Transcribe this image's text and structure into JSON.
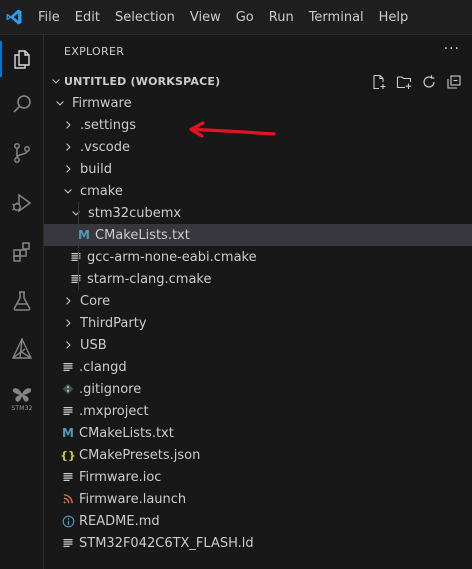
{
  "menubar": {
    "items": [
      "File",
      "Edit",
      "Selection",
      "View",
      "Go",
      "Run",
      "Terminal",
      "Help"
    ]
  },
  "activitybar": {
    "items": [
      "explorer",
      "search",
      "source-control",
      "run-and-debug",
      "extensions",
      "testing",
      "cmake",
      "stm32"
    ],
    "stm32_label": "STM32"
  },
  "explorer": {
    "header": "EXPLORER",
    "more": "···",
    "workspace_title": "UNTITLED (WORKSPACE)"
  },
  "tree": [
    {
      "label": "Firmware",
      "depth": 1,
      "type": "folder-open"
    },
    {
      "label": ".settings",
      "depth": 2,
      "type": "folder"
    },
    {
      "label": ".vscode",
      "depth": 2,
      "type": "folder"
    },
    {
      "label": "build",
      "depth": 2,
      "type": "folder"
    },
    {
      "label": "cmake",
      "depth": 2,
      "type": "folder-open"
    },
    {
      "label": "stm32cubemx",
      "depth": 3,
      "type": "folder-open"
    },
    {
      "label": "CMakeLists.txt",
      "depth": 4,
      "type": "cmake",
      "selected": true
    },
    {
      "label": "gcc-arm-none-eabi.cmake",
      "depth": 3,
      "type": "lines"
    },
    {
      "label": "starm-clang.cmake",
      "depth": 3,
      "type": "lines"
    },
    {
      "label": "Core",
      "depth": 2,
      "type": "folder"
    },
    {
      "label": "ThirdParty",
      "depth": 2,
      "type": "folder"
    },
    {
      "label": "USB",
      "depth": 2,
      "type": "folder"
    },
    {
      "label": ".clangd",
      "depth": 2,
      "type": "lines"
    },
    {
      "label": ".gitignore",
      "depth": 2,
      "type": "git"
    },
    {
      "label": ".mxproject",
      "depth": 2,
      "type": "lines"
    },
    {
      "label": "CMakeLists.txt",
      "depth": 2,
      "type": "cmake"
    },
    {
      "label": "CMakePresets.json",
      "depth": 2,
      "type": "json"
    },
    {
      "label": "Firmware.ioc",
      "depth": 2,
      "type": "lines"
    },
    {
      "label": "Firmware.launch",
      "depth": 2,
      "type": "rss"
    },
    {
      "label": "README.md",
      "depth": 2,
      "type": "info"
    },
    {
      "label": "STM32F042C6TX_FLASH.ld",
      "depth": 2,
      "type": "lines"
    }
  ],
  "colors": {
    "accent": "#0078d4",
    "annotation_arrow": "#e81123",
    "selection": "#37373d",
    "cmake_icon": "#519aba",
    "json_icon": "#cbcb41",
    "launch_icon": "#e37933"
  }
}
